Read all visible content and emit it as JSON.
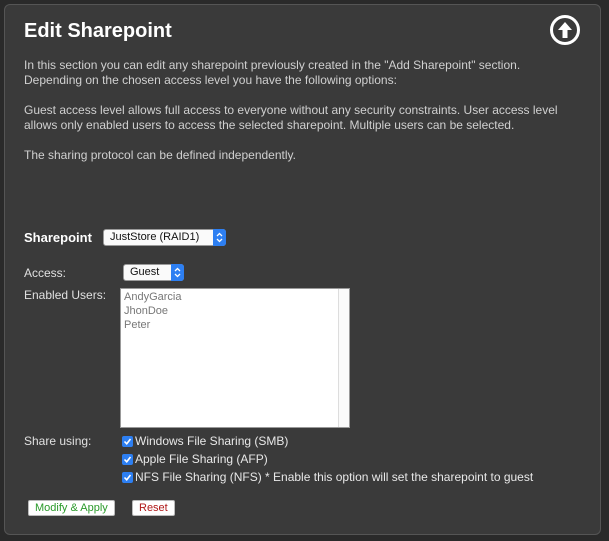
{
  "page": {
    "title": "Edit Sharepoint",
    "description": [
      "In this section you can edit any sharepoint previously created in the \"Add Sharepoint\" section. Depending on the chosen access level you have the following options:",
      "Guest access level allows full access to everyone without any security constraints. User access level allows only enabled users to access the selected sharepoint. Multiple users can be selected.",
      "The sharing protocol can be defined independently."
    ]
  },
  "icons": {
    "up": "arrow-up-circle-icon",
    "check": "checkmark-icon",
    "chevron": "updown-chevron-icon"
  },
  "form": {
    "sharepoint_label": "Sharepoint",
    "sharepoint_value": "JustStore (RAID1)",
    "access_label": "Access:",
    "access_value": "Guest",
    "users_label": "Enabled Users:",
    "users": [
      "AndyGarcia",
      "JhonDoe",
      "Peter"
    ],
    "share_label": "Share using:",
    "protocols": [
      {
        "label": "Windows File Sharing (SMB)",
        "checked": true
      },
      {
        "label": "Apple File Sharing (AFP)",
        "checked": true
      },
      {
        "label": "NFS File Sharing (NFS) * Enable this option will set the sharepoint to guest",
        "checked": true
      }
    ]
  },
  "buttons": {
    "apply": "Modify & Apply",
    "reset": "Reset"
  },
  "colors": {
    "accent": "#2d7ff2",
    "apply_text": "#2a9a2a",
    "reset_text": "#b01818",
    "panel": "#3a3a3a"
  }
}
